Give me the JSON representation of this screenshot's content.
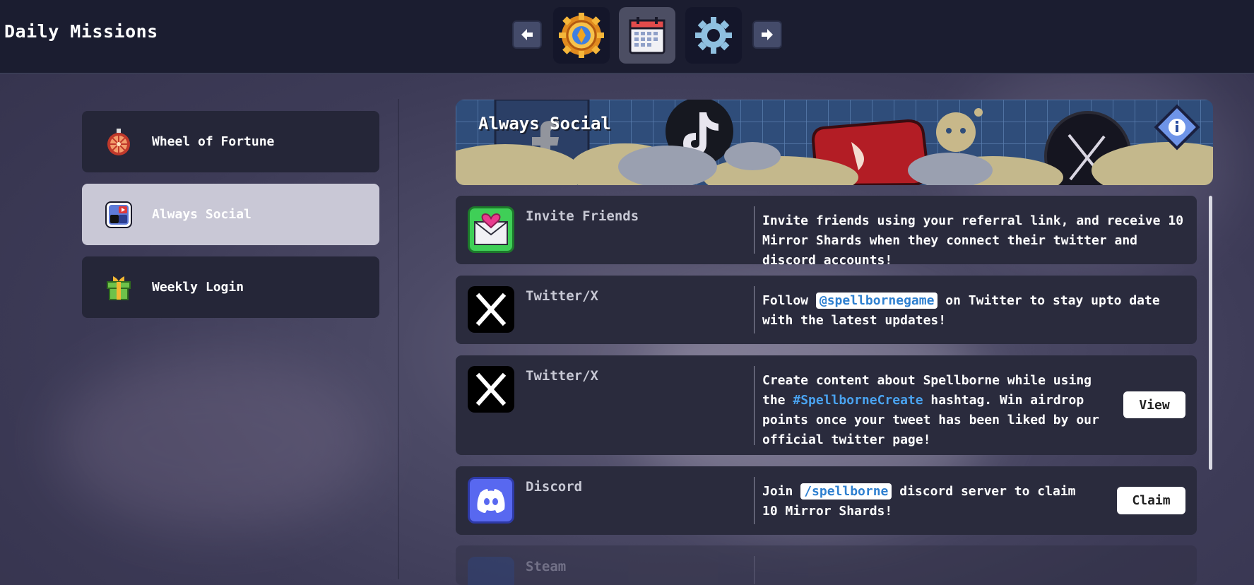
{
  "header": {
    "title": "Daily Missions",
    "nav": [
      {
        "name": "prev-arrow",
        "icon": "arrow-left-icon"
      },
      {
        "name": "badge",
        "icon": "gold-badge-icon"
      },
      {
        "name": "calendar",
        "icon": "calendar-icon",
        "active": true
      },
      {
        "name": "settings",
        "icon": "gear-icon"
      },
      {
        "name": "next-arrow",
        "icon": "arrow-right-icon"
      }
    ]
  },
  "sidebar": {
    "items": [
      {
        "label": "Wheel of Fortune",
        "icon": "wheel-icon"
      },
      {
        "label": "Always Social",
        "icon": "social-icon",
        "active": true
      },
      {
        "label": "Weekly Login",
        "icon": "gift-icon"
      }
    ]
  },
  "banner": {
    "title": "Always Social",
    "info_icon": "info-icon"
  },
  "missions": [
    {
      "name": "Invite Friends",
      "icon": "envelope-heart-icon",
      "desc": "Invite friends using your referral link, and receive 10 Mirror Shards when they connect their twitter and discord accounts!"
    },
    {
      "name": "Twitter/X",
      "icon": "x-logo-icon",
      "desc_pre": "Follow ",
      "desc_tag": "@spellbornegame",
      "desc_post": " on Twitter to stay upto date with the latest updates!"
    },
    {
      "name": "Twitter/X",
      "icon": "x-logo-icon",
      "desc_pre": "Create content about Spellborne while using the ",
      "desc_hash": "#SpellborneCreate",
      "desc_post": " hashtag. Win airdrop points once your tweet has been liked by our official twitter page!",
      "button": "View"
    },
    {
      "name": "Discord",
      "icon": "discord-icon",
      "desc_pre": "Join ",
      "desc_tag": "/spellborne",
      "desc_post": " discord server to claim 10 Mirror Shards!",
      "button": "Claim"
    },
    {
      "name": "Steam",
      "icon": "steam-icon"
    }
  ]
}
